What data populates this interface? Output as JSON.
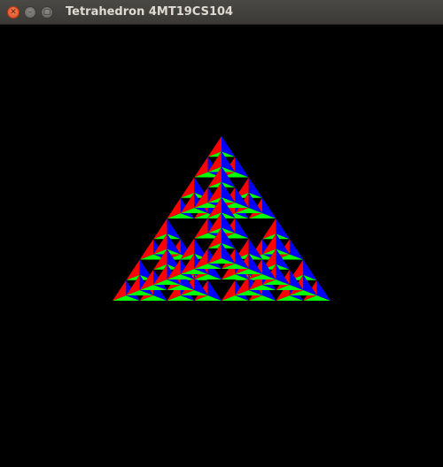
{
  "window": {
    "title": "Tetrahedron 4MT19CS104",
    "controls": {
      "close_icon": "close-icon",
      "minimize_icon": "minimize-icon",
      "maximize_icon": "maximize-icon"
    }
  },
  "scene": {
    "background": "#000000",
    "face_colors": {
      "left": "#ff0000",
      "right": "#0000ff",
      "bottom": "#00ff00",
      "back": "#000000"
    },
    "subdivision_levels": 3
  }
}
